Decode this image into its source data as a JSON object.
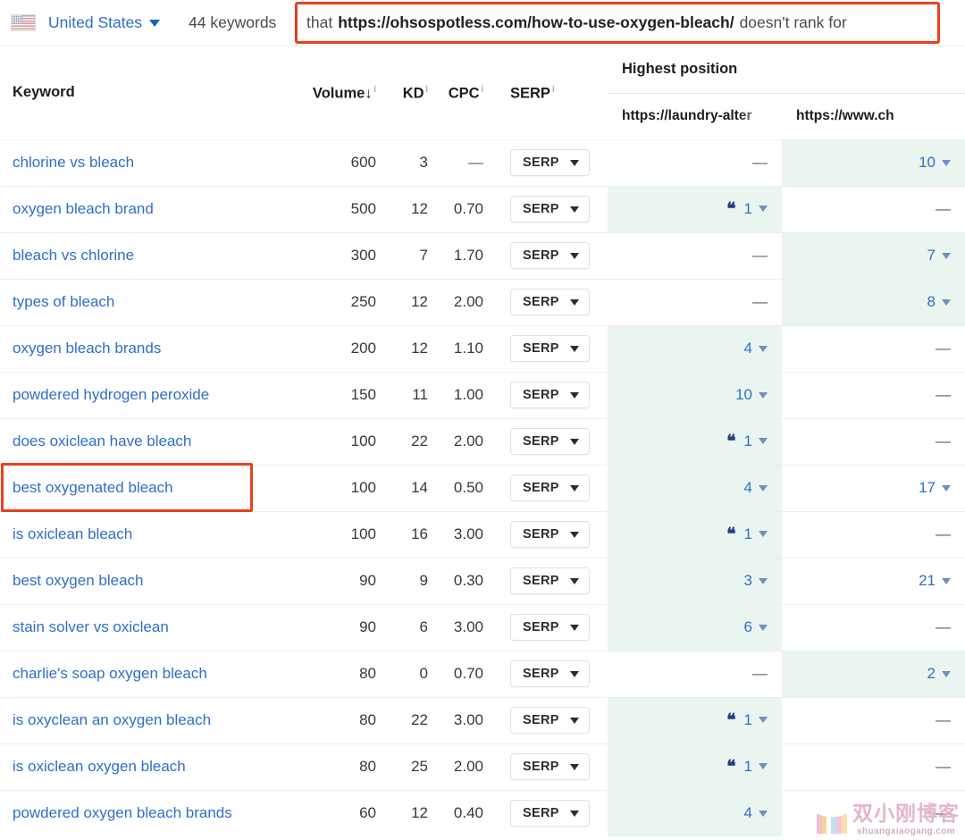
{
  "topbar": {
    "flag_icon": "us-flag-icon",
    "country": "United States",
    "country_caret_icon": "chevron-down-icon",
    "keyword_count": "44 keywords",
    "filter": {
      "prefix": "that",
      "url": "https://ohsospotless.com/how-to-use-oxygen-bleach/",
      "suffix": "doesn't rank for"
    }
  },
  "table": {
    "headers": {
      "keyword": "Keyword",
      "volume": "Volume",
      "volume_sort_icon": "↓",
      "kd": "KD",
      "cpc": "CPC",
      "serp": "SERP",
      "highest_position": "Highest position",
      "info_icon": "i"
    },
    "position_columns": [
      "https://laundry-alter",
      "https://www.ch"
    ],
    "serp_button_label": "SERP",
    "dash": "—",
    "quote_icon": "❝",
    "rows": [
      {
        "keyword": "chlorine vs bleach",
        "volume": "600",
        "kd": "3",
        "cpc": "—",
        "pos1": "—",
        "pos1_green": false,
        "pos1_snippet": false,
        "pos2": "10",
        "pos2_green": true,
        "pos2_snippet": false
      },
      {
        "keyword": "oxygen bleach brand",
        "volume": "500",
        "kd": "12",
        "cpc": "0.70",
        "pos1": "1",
        "pos1_green": true,
        "pos1_snippet": true,
        "pos2": "—",
        "pos2_green": false,
        "pos2_snippet": false
      },
      {
        "keyword": "bleach vs chlorine",
        "volume": "300",
        "kd": "7",
        "cpc": "1.70",
        "pos1": "—",
        "pos1_green": false,
        "pos1_snippet": false,
        "pos2": "7",
        "pos2_green": true,
        "pos2_snippet": false
      },
      {
        "keyword": "types of bleach",
        "volume": "250",
        "kd": "12",
        "cpc": "2.00",
        "pos1": "—",
        "pos1_green": false,
        "pos1_snippet": false,
        "pos2": "8",
        "pos2_green": true,
        "pos2_snippet": false
      },
      {
        "keyword": "oxygen bleach brands",
        "volume": "200",
        "kd": "12",
        "cpc": "1.10",
        "pos1": "4",
        "pos1_green": true,
        "pos1_snippet": false,
        "pos2": "—",
        "pos2_green": false,
        "pos2_snippet": false
      },
      {
        "keyword": "powdered hydrogen peroxide",
        "volume": "150",
        "kd": "11",
        "cpc": "1.00",
        "pos1": "10",
        "pos1_green": true,
        "pos1_snippet": false,
        "pos2": "—",
        "pos2_green": false,
        "pos2_snippet": false
      },
      {
        "keyword": "does oxiclean have bleach",
        "volume": "100",
        "kd": "22",
        "cpc": "2.00",
        "pos1": "1",
        "pos1_green": true,
        "pos1_snippet": true,
        "pos2": "—",
        "pos2_green": false,
        "pos2_snippet": false
      },
      {
        "keyword": "best oxygenated bleach",
        "volume": "100",
        "kd": "14",
        "cpc": "0.50",
        "pos1": "4",
        "pos1_green": true,
        "pos1_snippet": false,
        "pos2": "17",
        "pos2_green": false,
        "pos2_snippet": false,
        "highlighted": true
      },
      {
        "keyword": "is oxiclean bleach",
        "volume": "100",
        "kd": "16",
        "cpc": "3.00",
        "pos1": "1",
        "pos1_green": true,
        "pos1_snippet": true,
        "pos2": "—",
        "pos2_green": false,
        "pos2_snippet": false
      },
      {
        "keyword": "best oxygen bleach",
        "volume": "90",
        "kd": "9",
        "cpc": "0.30",
        "pos1": "3",
        "pos1_green": true,
        "pos1_snippet": false,
        "pos2": "21",
        "pos2_green": false,
        "pos2_snippet": false
      },
      {
        "keyword": "stain solver vs oxiclean",
        "volume": "90",
        "kd": "6",
        "cpc": "3.00",
        "pos1": "6",
        "pos1_green": true,
        "pos1_snippet": false,
        "pos2": "—",
        "pos2_green": false,
        "pos2_snippet": false
      },
      {
        "keyword": "charlie's soap oxygen bleach",
        "volume": "80",
        "kd": "0",
        "cpc": "0.70",
        "pos1": "—",
        "pos1_green": false,
        "pos1_snippet": false,
        "pos2": "2",
        "pos2_green": true,
        "pos2_snippet": false
      },
      {
        "keyword": "is oxyclean an oxygen bleach",
        "volume": "80",
        "kd": "22",
        "cpc": "3.00",
        "pos1": "1",
        "pos1_green": true,
        "pos1_snippet": true,
        "pos2": "—",
        "pos2_green": false,
        "pos2_snippet": false
      },
      {
        "keyword": "is oxiclean oxygen bleach",
        "volume": "80",
        "kd": "25",
        "cpc": "2.00",
        "pos1": "1",
        "pos1_green": true,
        "pos1_snippet": true,
        "pos2": "—",
        "pos2_green": false,
        "pos2_snippet": false
      },
      {
        "keyword": "powdered oxygen bleach brands",
        "volume": "60",
        "kd": "12",
        "cpc": "0.40",
        "pos1": "4",
        "pos1_green": true,
        "pos1_snippet": false,
        "pos2": "—",
        "pos2_green": false,
        "pos2_snippet": false
      }
    ]
  },
  "watermark": {
    "name": "双小刚博客",
    "url": "shuangxiaogang.com"
  },
  "colors": {
    "link": "#2f6ecc",
    "highlight_box": "#e8411f",
    "cell_green": "#e9f5ee",
    "snippet_icon": "#1e3f82"
  }
}
